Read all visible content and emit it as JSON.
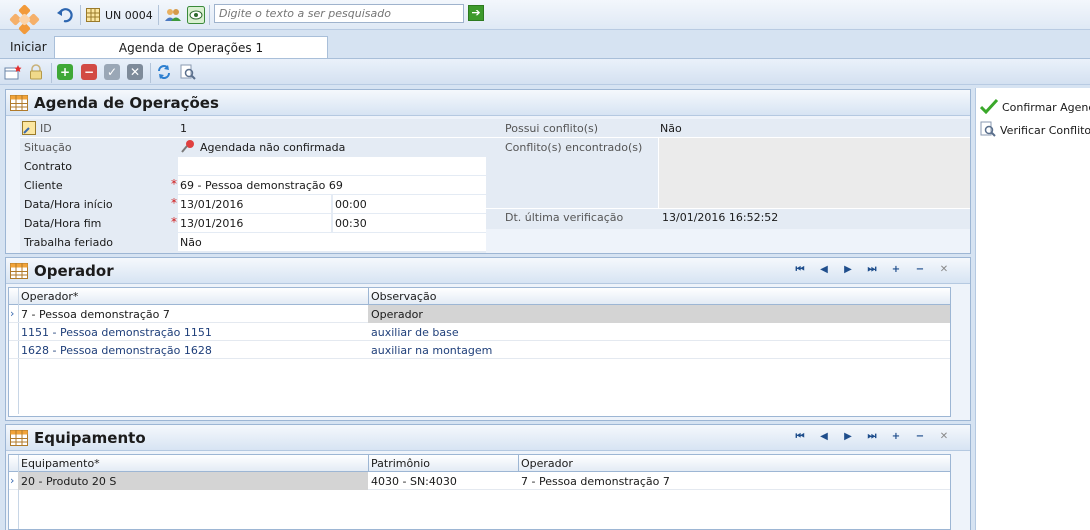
{
  "topbar": {
    "unit_label": "UN 0004",
    "search_placeholder": "Digite o texto a ser pesquisado"
  },
  "home_label": "Iniciar",
  "tab_label": "Agenda de Operações 1",
  "agenda": {
    "title": "Agenda de Operações",
    "fields": {
      "id_label": "ID",
      "id_value": "1",
      "situacao_label": "Situação",
      "situacao_value": "Agendada não confirmada",
      "contrato_label": "Contrato",
      "contrato_value": "",
      "cliente_label": "Cliente",
      "cliente_value": "69 - Pessoa demonstração 69",
      "inicio_label": "Data/Hora início",
      "inicio_date": "13/01/2016",
      "inicio_time": "00:00",
      "fim_label": "Data/Hora fim",
      "fim_date": "13/01/2016",
      "fim_time": "00:30",
      "feriado_label": "Trabalha feriado",
      "feriado_value": "Não",
      "conflito_label": "Possui conflito(s)",
      "conflito_value": "Não",
      "encontrado_label": "Conflito(s) encontrado(s)",
      "verificacao_label": "Dt. última verificação",
      "verificacao_value": "13/01/2016 16:52:52"
    }
  },
  "operador": {
    "title": "Operador",
    "columns": [
      "Operador*",
      "Observação"
    ],
    "rows": [
      [
        "7 - Pessoa demonstração 7",
        "Operador"
      ],
      [
        "1151 - Pessoa demonstração 1151",
        "auxiliar de base"
      ],
      [
        "1628 - Pessoa demonstração 1628",
        "auxiliar na montagem"
      ]
    ]
  },
  "equipamento": {
    "title": "Equipamento",
    "columns": [
      "Equipamento*",
      "Patrimônio",
      "Operador"
    ],
    "rows": [
      [
        "20 - Produto 20 S",
        "4030 - SN:4030",
        "7 - Pessoa demonstração 7"
      ]
    ]
  },
  "actions": {
    "confirm_label": "Confirmar Agenda",
    "verify_label": "Verificar Conflitos"
  },
  "colors": {
    "accent": "#1f4e8c",
    "panel_bg": "#eef3fa",
    "required": "#d01818",
    "selected_row": "#d4d4d4"
  }
}
